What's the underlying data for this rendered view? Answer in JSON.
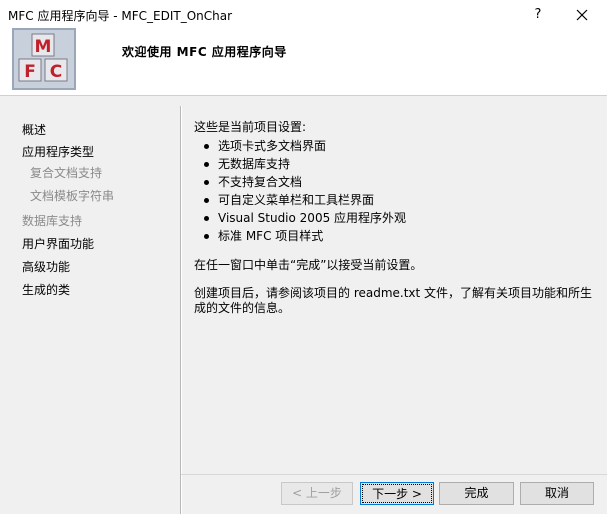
{
  "window": {
    "title": "MFC 应用程序向导 - MFC_EDIT_OnChar",
    "help_label": "?"
  },
  "banner": {
    "title": "欢迎使用 MFC 应用程序向导",
    "logo_letters": [
      "M",
      "F",
      "C"
    ]
  },
  "sidebar": {
    "items": [
      {
        "label": "概述",
        "state": "current"
      },
      {
        "label": "应用程序类型",
        "state": "enabled"
      },
      {
        "label": "复合文档支持",
        "state": "disabled"
      },
      {
        "label": "文档模板字符串",
        "state": "disabled"
      },
      {
        "label": "数据库支持",
        "state": "disabled"
      },
      {
        "label": "用户界面功能",
        "state": "enabled"
      },
      {
        "label": "高级功能",
        "state": "enabled"
      },
      {
        "label": "生成的类",
        "state": "enabled"
      }
    ]
  },
  "main": {
    "intro": "这些是当前项目设置:",
    "bullets": [
      "选项卡式多文档界面",
      "无数据库支持",
      "不支持复合文档",
      "可自定义菜单栏和工具栏界面",
      "Visual Studio 2005 应用程序外观",
      "标准 MFC 项目样式"
    ],
    "instruction": "在任一窗口中单击“完成”以接受当前设置。",
    "note_line1": "创建项目后，请参阅该项目的 readme.txt 文件，了解有关项目功能和所生",
    "note_line2": "成的文件的信息。"
  },
  "buttons": {
    "back": "< 上一步",
    "next": "下一步 >",
    "finish": "完成",
    "cancel": "取消"
  },
  "colors": {
    "accent": "#0078d7",
    "panel": "#f0f0f0",
    "disabled_text": "#8a8a8a"
  }
}
